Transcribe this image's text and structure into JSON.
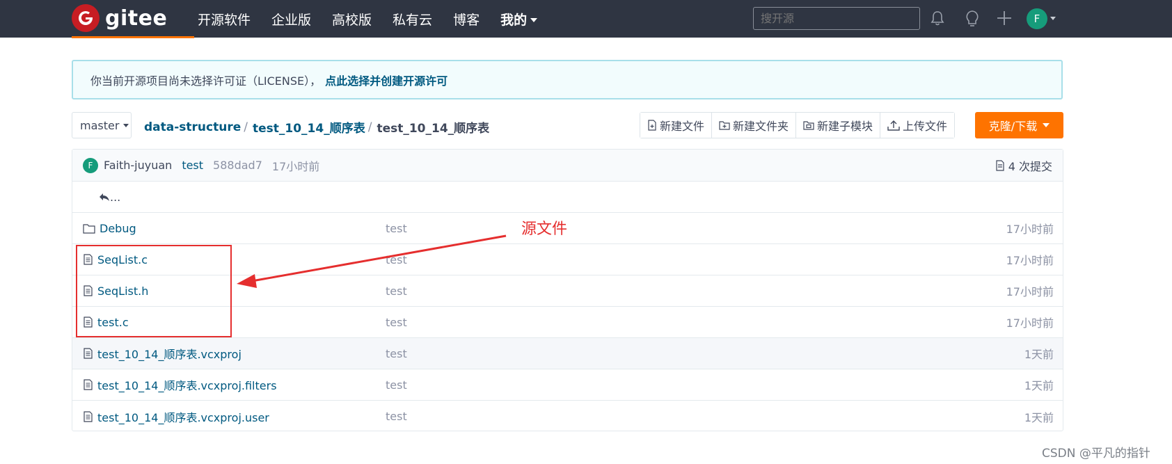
{
  "header": {
    "logo_text": "gitee",
    "nav": [
      {
        "label": "开源软件"
      },
      {
        "label": "企业版"
      },
      {
        "label": "高校版"
      },
      {
        "label": "私有云"
      },
      {
        "label": "博客"
      },
      {
        "label": "我的"
      }
    ],
    "search_placeholder": "搜开源",
    "avatar_letter": "F",
    "icons": [
      "bell-icon",
      "lightbulb-icon",
      "plus-icon"
    ]
  },
  "notice": {
    "text": "你当前开源项目尚未选择许可证（LICENSE），",
    "link": "点此选择并创建开源许可"
  },
  "toolbar": {
    "branch": "master",
    "breadcrumb": [
      "data-structure",
      "test_10_14_顺序表",
      "test_10_14_顺序表"
    ],
    "buttons": [
      {
        "label": "新建文件",
        "icon": "new-file-icon"
      },
      {
        "label": "新建文件夹",
        "icon": "new-folder-icon"
      },
      {
        "label": "新建子模块",
        "icon": "submodule-icon"
      },
      {
        "label": "上传文件",
        "icon": "upload-icon"
      }
    ],
    "clone_label": "克隆/下载",
    "accent_color": "#fe7300"
  },
  "commit": {
    "avatar_letter": "F",
    "author": "Faith-juyuan",
    "message": "test",
    "sha": "588dad7",
    "time": "17小时前",
    "count_label": "4 次提交"
  },
  "files": {
    "back_label": "...",
    "rows": [
      {
        "name": "Debug",
        "type": "folder",
        "message": "test",
        "time": "17小时前"
      },
      {
        "name": "SeqList.c",
        "type": "file",
        "message": "test",
        "time": "17小时前"
      },
      {
        "name": "SeqList.h",
        "type": "file",
        "message": "test",
        "time": "17小时前"
      },
      {
        "name": "test.c",
        "type": "file",
        "message": "test",
        "time": "17小时前"
      },
      {
        "name": "test_10_14_顺序表.vcxproj",
        "type": "file",
        "message": "test",
        "time": "1天前"
      },
      {
        "name": "test_10_14_顺序表.vcxproj.filters",
        "type": "file",
        "message": "test",
        "time": "1天前"
      },
      {
        "name": "test_10_14_顺序表.vcxproj.user",
        "type": "file",
        "message": "test",
        "time": "1天前"
      }
    ]
  },
  "annotation": {
    "label": "源文件",
    "color": "#e52e2e"
  },
  "watermark": "CSDN @平凡的指针"
}
